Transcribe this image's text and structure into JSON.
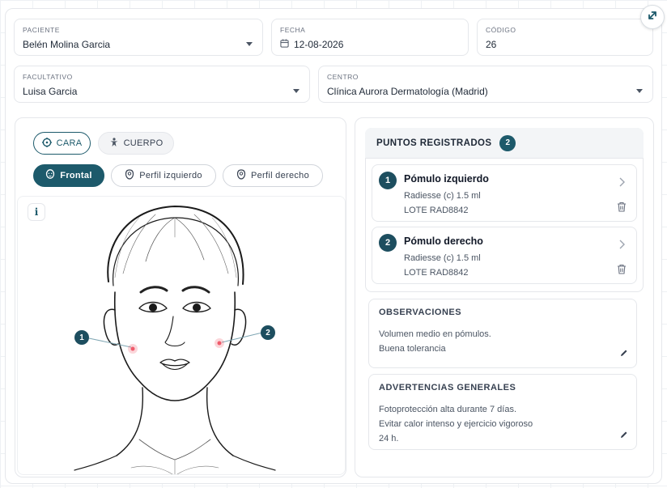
{
  "header": {
    "paciente": {
      "label": "PACIENTE",
      "value": "Belén Molina Garcia"
    },
    "fecha": {
      "label": "FECHA",
      "value": "12-08-2026"
    },
    "codigo": {
      "label": "CÓDIGO",
      "value": "26"
    },
    "facultativo": {
      "label": "FACULTATIVO",
      "value": "Luisa Garcia"
    },
    "centro": {
      "label": "CENTRO",
      "value": "Clínica Aurora Dermatología (Madrid)"
    }
  },
  "body_tabs": {
    "cara": "CARA",
    "cuerpo": "CUERPO",
    "selected": "CARA"
  },
  "view_tabs": {
    "frontal": "Frontal",
    "perfil_izquierdo": "Perfil izquierdo",
    "perfil_derecho": "Perfil derecho",
    "selected": "Frontal"
  },
  "face": {
    "info_icon": "i",
    "markers": [
      {
        "label": "1",
        "zone": "Pómulo izquierdo"
      },
      {
        "label": "2",
        "zone": "Pómulo derecho"
      }
    ]
  },
  "points": {
    "title": "PUNTOS REGISTRADOS",
    "count": "2",
    "items": [
      {
        "number": "1",
        "title": "Pómulo izquierdo",
        "product": "Radiesse (c) 1.5 ml",
        "lot": "LOTE RAD8842"
      },
      {
        "number": "2",
        "title": "Pómulo derecho",
        "product": "Radiesse (c) 1.5 ml",
        "lot": "LOTE RAD8842"
      }
    ]
  },
  "observaciones": {
    "title": "OBSERVACIONES",
    "lines": [
      "Volumen medio en pómulos.",
      "Buena tolerancia"
    ]
  },
  "advertencias": {
    "title": "ADVERTENCIAS GENERALES",
    "lines": [
      "Fotoprotección alta durante 7 días.",
      "Evitar calor intenso y ejercicio vigoroso",
      "24 h."
    ]
  },
  "colors": {
    "accent": "#1d5a6b",
    "marker": "#1d4e5f",
    "injection": "#ef5b6b"
  }
}
